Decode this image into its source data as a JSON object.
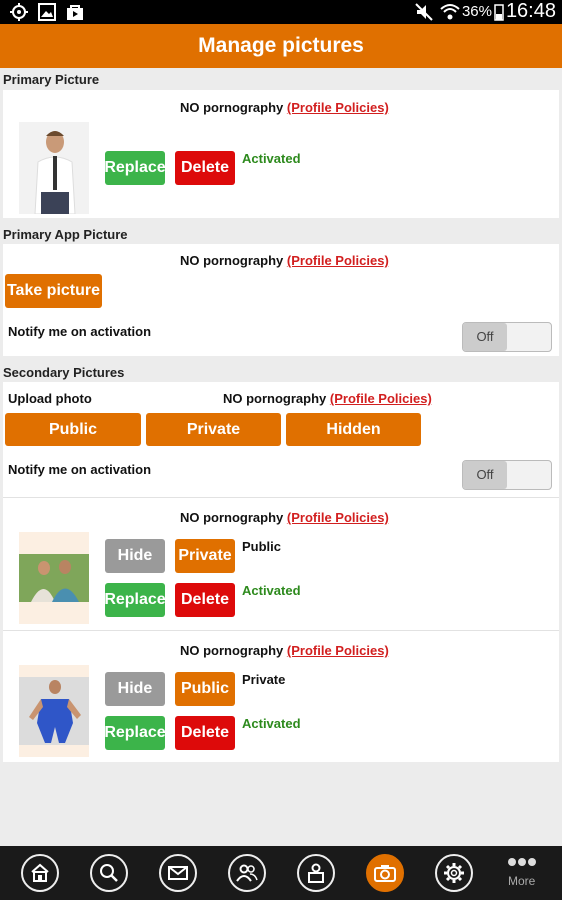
{
  "status_bar": {
    "battery_pct": "36%",
    "time": "16:48"
  },
  "header": {
    "title": "Manage pictures"
  },
  "policy": {
    "prefix": "NO pornography",
    "link": "(Profile Policies)"
  },
  "primary": {
    "title": "Primary Picture",
    "replace": "Replace",
    "delete": "Delete",
    "status": "Activated"
  },
  "app": {
    "title": "Primary App Picture",
    "take_picture": "Take picture",
    "notify": "Notify me on activation",
    "toggle": "Off"
  },
  "secondary": {
    "title": "Secondary Pictures",
    "upload": "Upload photo",
    "public_btn": "Public",
    "private_btn": "Private",
    "hidden_btn": "Hidden",
    "notify": "Notify me on activation",
    "toggle": "Off",
    "items": [
      {
        "hide": "Hide",
        "toggle_vis": "Private",
        "visibility": "Public",
        "replace": "Replace",
        "delete": "Delete",
        "status": "Activated"
      },
      {
        "hide": "Hide",
        "toggle_vis": "Public",
        "visibility": "Private",
        "replace": "Replace",
        "delete": "Delete",
        "status": "Activated"
      }
    ]
  },
  "nav": {
    "items": [
      "home-icon",
      "search-icon",
      "mail-icon",
      "people-icon",
      "profile-icon",
      "camera-icon",
      "gear-icon"
    ],
    "more_label": "More",
    "active_color": "#e07000"
  },
  "colors": {
    "accent": "#e07000",
    "green": "#3cb44a",
    "red": "#dd0a0a",
    "gray": "#9a9a9a"
  }
}
